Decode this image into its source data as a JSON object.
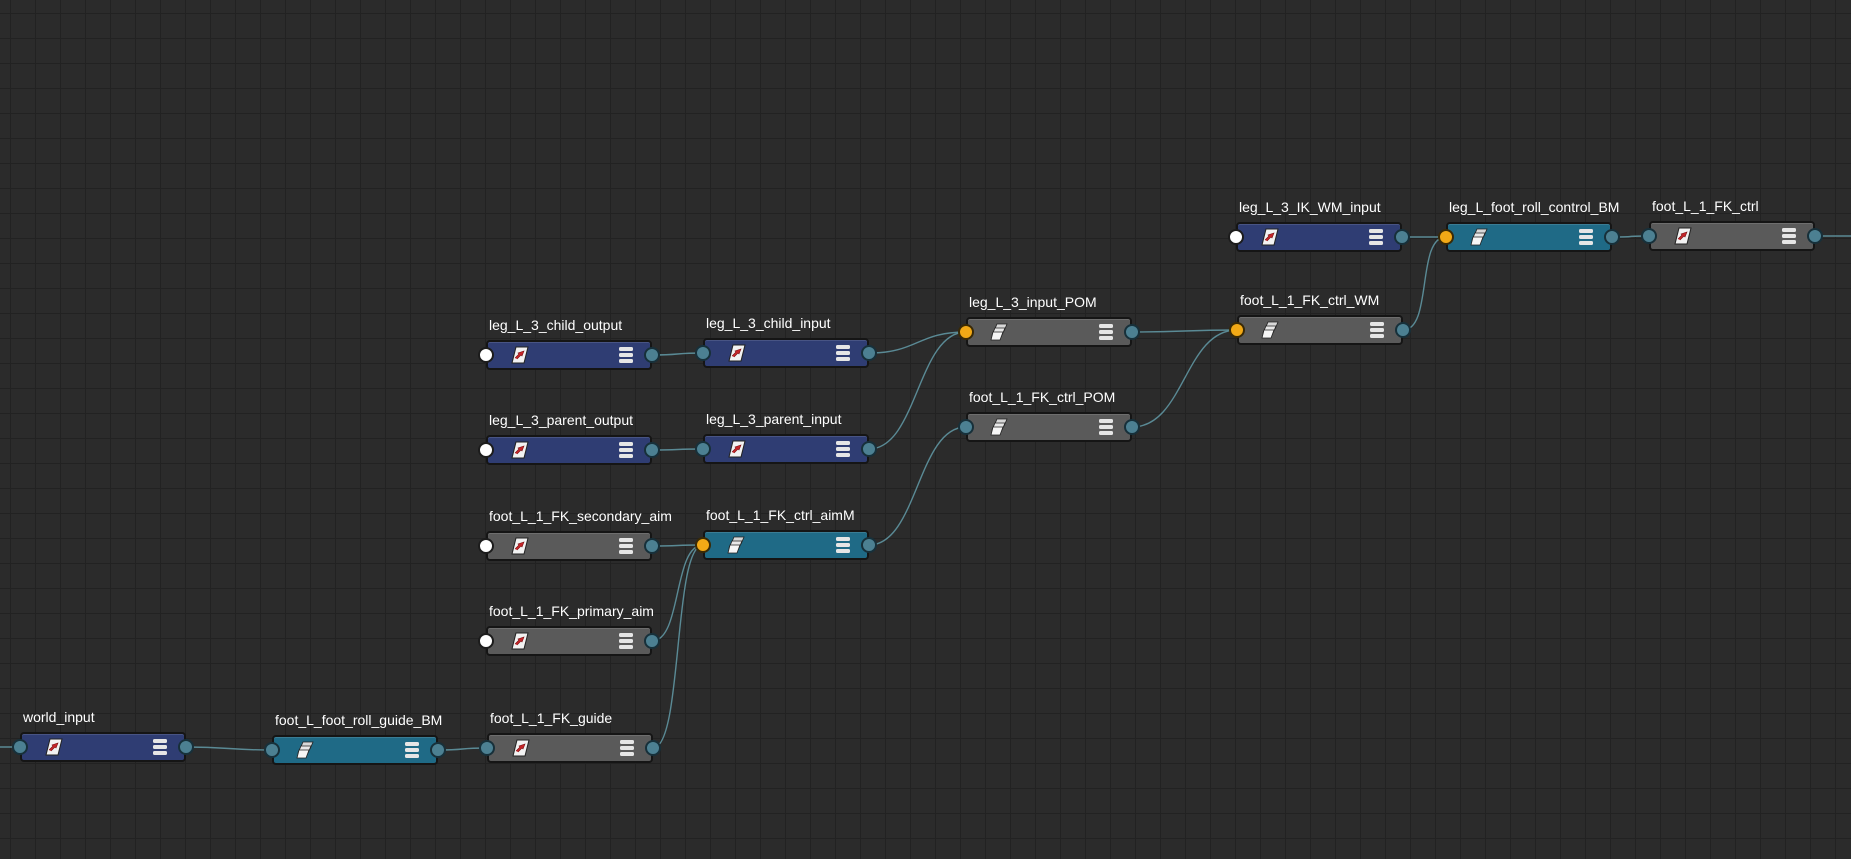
{
  "graph": {
    "nodes": [
      {
        "id": "world_input",
        "label": "world_input",
        "style": "blue",
        "icon": "transform-icon",
        "input_port": "teal"
      },
      {
        "id": "foot_L_foot_roll_guide_BM",
        "label": "foot_L_foot_roll_guide_BM",
        "style": "teal",
        "icon": "matrix-stack-icon",
        "input_port": "teal"
      },
      {
        "id": "foot_L_1_FK_guide",
        "label": "foot_L_1_FK_guide",
        "style": "gray",
        "icon": "transform-icon",
        "input_port": "teal"
      },
      {
        "id": "leg_L_3_child_output",
        "label": "leg_L_3_child_output",
        "style": "blue",
        "icon": "transform-icon",
        "input_port": "white"
      },
      {
        "id": "leg_L_3_parent_output",
        "label": "leg_L_3_parent_output",
        "style": "blue",
        "icon": "transform-icon",
        "input_port": "white"
      },
      {
        "id": "foot_L_1_FK_secondary_aim",
        "label": "foot_L_1_FK_secondary_aim",
        "style": "gray",
        "icon": "transform-icon",
        "input_port": "white"
      },
      {
        "id": "foot_L_1_FK_primary_aim",
        "label": "foot_L_1_FK_primary_aim",
        "style": "gray",
        "icon": "transform-icon",
        "input_port": "white"
      },
      {
        "id": "leg_L_3_child_input",
        "label": "leg_L_3_child_input",
        "style": "blue",
        "icon": "transform-icon",
        "input_port": "teal"
      },
      {
        "id": "leg_L_3_parent_input",
        "label": "leg_L_3_parent_input",
        "style": "blue",
        "icon": "transform-icon",
        "input_port": "teal"
      },
      {
        "id": "foot_L_1_FK_ctrl_aimM",
        "label": "foot_L_1_FK_ctrl_aimM",
        "style": "teal",
        "icon": "matrix-stack-icon",
        "input_port": "orange"
      },
      {
        "id": "leg_L_3_input_POM",
        "label": "leg_L_3_input_POM",
        "style": "gray",
        "icon": "matrix-stack-icon",
        "input_port": "orange"
      },
      {
        "id": "foot_L_1_FK_ctrl_POM",
        "label": "foot_L_1_FK_ctrl_POM",
        "style": "gray",
        "icon": "matrix-stack-icon",
        "input_port": "teal"
      },
      {
        "id": "leg_L_3_IK_WM_input",
        "label": "leg_L_3_IK_WM_input",
        "style": "blue",
        "icon": "transform-icon",
        "input_port": "white"
      },
      {
        "id": "foot_L_1_FK_ctrl_WM",
        "label": "foot_L_1_FK_ctrl_WM",
        "style": "gray",
        "icon": "matrix-stack-icon",
        "input_port": "orange"
      },
      {
        "id": "leg_L_foot_roll_control_BM",
        "label": "leg_L_foot_roll_control_BM",
        "style": "teal",
        "icon": "matrix-stack-icon",
        "input_port": "orange"
      },
      {
        "id": "foot_L_1_FK_ctrl",
        "label": "foot_L_1_FK_ctrl",
        "style": "gray",
        "icon": "transform-icon",
        "input_port": "teal"
      }
    ],
    "connections": [
      {
        "from": "world_input",
        "to": "foot_L_foot_roll_guide_BM"
      },
      {
        "from": "foot_L_foot_roll_guide_BM",
        "to": "foot_L_1_FK_guide"
      },
      {
        "from": "foot_L_1_FK_guide",
        "to": "foot_L_1_FK_ctrl_aimM"
      },
      {
        "from": "foot_L_1_FK_primary_aim",
        "to": "foot_L_1_FK_ctrl_aimM"
      },
      {
        "from": "foot_L_1_FK_secondary_aim",
        "to": "foot_L_1_FK_ctrl_aimM"
      },
      {
        "from": "leg_L_3_child_output",
        "to": "leg_L_3_child_input"
      },
      {
        "from": "leg_L_3_parent_output",
        "to": "leg_L_3_parent_input"
      },
      {
        "from": "leg_L_3_child_input",
        "to": "leg_L_3_input_POM"
      },
      {
        "from": "leg_L_3_parent_input",
        "to": "leg_L_3_input_POM"
      },
      {
        "from": "foot_L_1_FK_ctrl_aimM",
        "to": "foot_L_1_FK_ctrl_POM"
      },
      {
        "from": "leg_L_3_input_POM",
        "to": "foot_L_1_FK_ctrl_WM"
      },
      {
        "from": "foot_L_1_FK_ctrl_POM",
        "to": "foot_L_1_FK_ctrl_WM"
      },
      {
        "from": "foot_L_1_FK_ctrl_WM",
        "to": "leg_L_foot_roll_control_BM"
      },
      {
        "from": "leg_L_3_IK_WM_input",
        "to": "leg_L_foot_roll_control_BM"
      },
      {
        "from": "leg_L_foot_roll_control_BM",
        "to": "foot_L_1_FK_ctrl"
      }
    ]
  },
  "colors": {
    "canvas": "#2b2b2b",
    "grid": "#222222",
    "wire": "#5a8a95",
    "node_blue": "#2f3d73",
    "node_gray": "#5a5a5a",
    "node_teal": "#1f6a86",
    "port_teal": "#4c8092",
    "port_orange": "#f2a916",
    "port_white": "#ffffff"
  }
}
